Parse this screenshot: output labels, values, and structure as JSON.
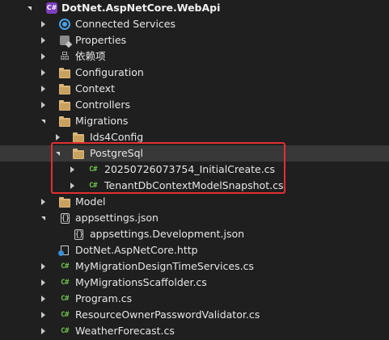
{
  "project": {
    "name": "DotNet.AspNetCore.WebApi",
    "icon": "csharp-project-icon"
  },
  "tree": {
    "connected_services": "Connected Services",
    "properties": "Properties",
    "dependencies": "依赖项",
    "configuration": "Configuration",
    "context": "Context",
    "controllers": "Controllers",
    "migrations": "Migrations",
    "ids4config": "Ids4Config",
    "postgresql": "PostgreSql",
    "initial_create": "20250726073754_InitialCreate.cs",
    "snapshot": "TenantDbContextModelSnapshot.cs",
    "model": "Model",
    "appsettings": "appsettings.json",
    "appsettings_dev": "appsettings.Development.json",
    "http_file": "DotNet.AspNetCore.http",
    "design_time": "MyMigrationDesignTimeServices.cs",
    "scaffolder": "MyMigrationsScaffolder.cs",
    "program": "Program.cs",
    "resource_owner": "ResourceOwnerPasswordValidator.cs",
    "weather": "WeatherForecast.cs"
  },
  "icons": {
    "cs_glyph": "C#",
    "json_glyph": "{}",
    "project_glyph": "C#",
    "deps_glyph": "品"
  },
  "colors": {
    "background": "#1f1f1f",
    "selected_row": "#383838",
    "folder": "#dcb67a",
    "csharp": "#6fbf4a",
    "highlight": "#e03030"
  }
}
